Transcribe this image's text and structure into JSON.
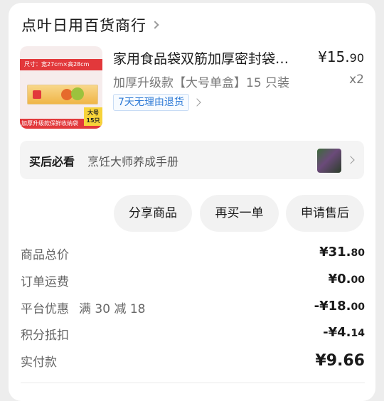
{
  "shop": {
    "name": "点叶日用百货商行"
  },
  "product": {
    "title": "家用食品袋双筋加厚密封袋…",
    "spec": "加厚升级款【大号单盒】15 只装",
    "badge": "7天无理由退货",
    "price_main": "¥15.",
    "price_cents": "90",
    "quantity": "x2",
    "image": {
      "top_text": "尺寸：宽27cm×高28cm",
      "bottom_text": "加厚升级款保鲜收纳袋",
      "size_tag_line1": "大号",
      "size_tag_line2": "15只"
    }
  },
  "after_purchase": {
    "label": "买后必看",
    "description": "烹饪大师养成手册"
  },
  "actions": {
    "share": "分享商品",
    "rebuy": "再买一单",
    "after_sale": "申请售后"
  },
  "summary": {
    "goods_total": {
      "label": "商品总价",
      "main": "¥31.",
      "cents": "80"
    },
    "shipping": {
      "label": "订单运费",
      "main": "¥0.",
      "cents": "00"
    },
    "platform_discount": {
      "label": "平台优惠",
      "note": "满 30 减 18",
      "main": "-¥18.",
      "cents": "00"
    },
    "points": {
      "label": "积分抵扣",
      "main": "-¥4.",
      "cents": "14"
    },
    "paid": {
      "label": "实付款",
      "value": "¥9.66"
    }
  }
}
